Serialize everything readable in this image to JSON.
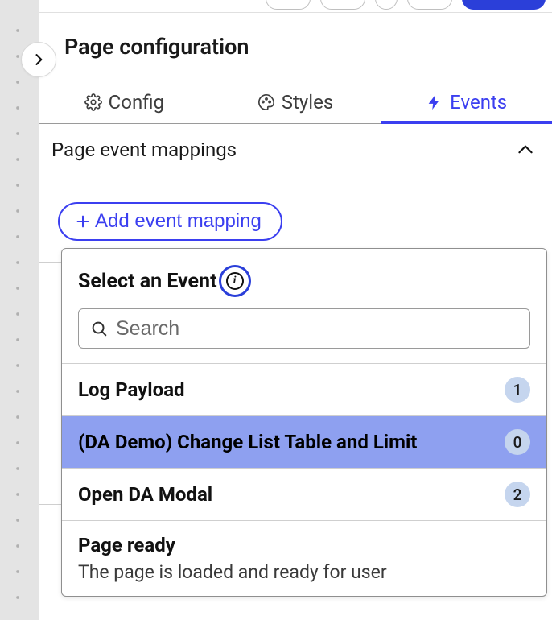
{
  "header": {
    "title": "Page configuration"
  },
  "tabs": [
    {
      "label": "Config",
      "icon": "gear-icon",
      "active": false
    },
    {
      "label": "Styles",
      "icon": "palette-icon",
      "active": false
    },
    {
      "label": "Events",
      "icon": "bolt-icon",
      "active": true
    }
  ],
  "section": {
    "title": "Page event mappings",
    "expanded": true
  },
  "add_button": {
    "label": "Add event mapping"
  },
  "popover": {
    "title": "Select an Event",
    "search": {
      "placeholder": "Search",
      "value": ""
    },
    "events": [
      {
        "name": "Log Payload",
        "count": 1,
        "highlighted": false
      },
      {
        "name": "(DA Demo) Change List Table and Limit",
        "count": 0,
        "highlighted": true
      },
      {
        "name": "Open DA Modal",
        "count": 2,
        "highlighted": false
      },
      {
        "name": "Page ready",
        "desc": "The page is loaded and ready for user",
        "highlighted": false
      }
    ]
  },
  "colors": {
    "accent": "#3b3ff0",
    "highlight_bg": "#8ea0f0",
    "badge_bg": "#c5d5ee"
  }
}
